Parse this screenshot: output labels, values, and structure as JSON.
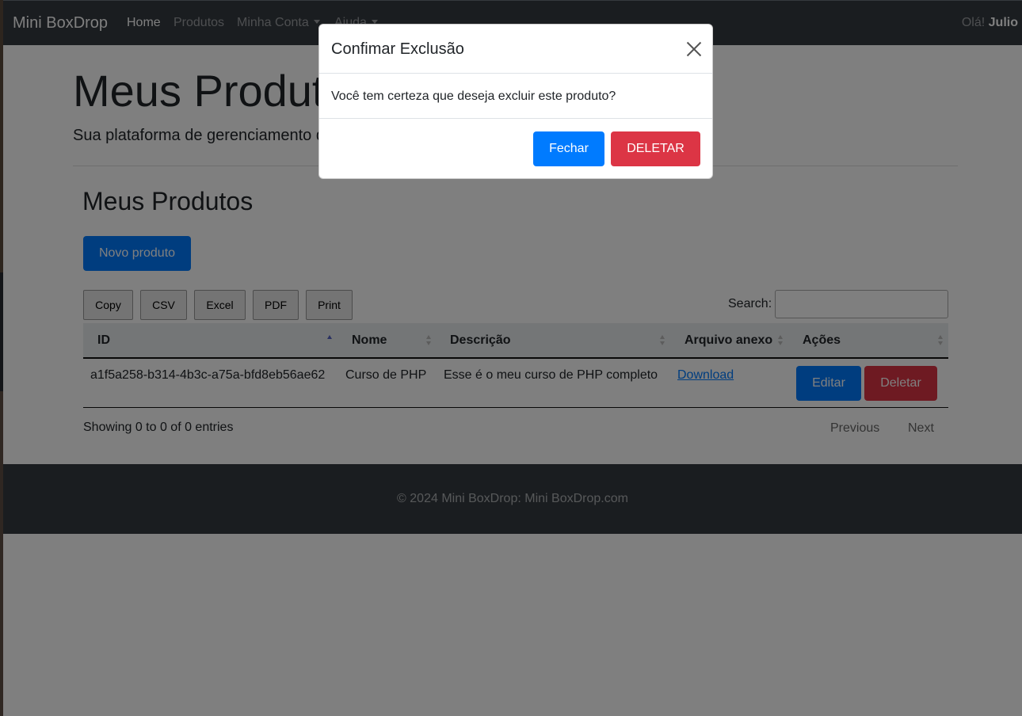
{
  "navbar": {
    "brand": "Mini BoxDrop",
    "links": [
      "Home",
      "Produtos",
      "Minha Conta",
      "Ajuda"
    ],
    "greeting_prefix": "Olá!",
    "user_name": "Julio"
  },
  "hero": {
    "title": "Meus Produtos",
    "lead": "Sua plataforma de gerenciamento de produtos"
  },
  "section": {
    "title": "Meus Produtos",
    "new_button": "Novo produto"
  },
  "export_buttons": [
    "Copy",
    "CSV",
    "Excel",
    "PDF",
    "Print"
  ],
  "search": {
    "label": "Search:",
    "value": ""
  },
  "table": {
    "headers": [
      "ID",
      "Nome",
      "Descrição",
      "Arquivo anexo",
      "Ações"
    ],
    "rows": [
      {
        "id": "a1f5a258-b314-4b3c-a75a-bfd8eb56ae62",
        "nome": "Curso de PHP",
        "descricao": "Esse é o meu curso de PHP completo",
        "arquivo": "Download",
        "edit_label": "Editar",
        "delete_label": "Deletar"
      }
    ],
    "info": "Showing 0 to 0 of 0 entries",
    "previous": "Previous",
    "next": "Next"
  },
  "footer": {
    "text": "© 2024 Mini BoxDrop: Mini BoxDrop.com"
  },
  "modal": {
    "title": "Confimar Exclusão",
    "body": "Você tem certeza que deseja excluir este produto?",
    "close_button": "Fechar",
    "confirm_button": "DELETAR"
  },
  "colors": {
    "primary": "#007bff",
    "danger": "#dc3545",
    "navbar": "#343a40"
  }
}
